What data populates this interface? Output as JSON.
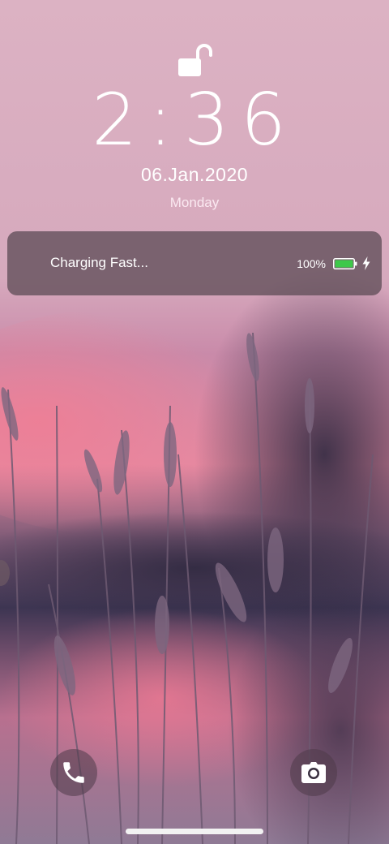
{
  "lock_screen": {
    "lock_icon": "unlocked-padlock-icon",
    "time": "2:36",
    "date": "06.Jan.2020",
    "day": "Monday"
  },
  "notification": {
    "text": "Charging Fast...",
    "battery_percent": "100%",
    "battery_level": 1.0,
    "battery_icon": "battery-full-icon",
    "charging_icon": "lightning-bolt-icon",
    "battery_color": "#3ec84a"
  },
  "shortcuts": {
    "left_icon": "phone-icon",
    "right_icon": "camera-icon"
  },
  "colors": {
    "sky": "#d9b0c2",
    "notification_bg": "#604e58",
    "dusk_glow": "#e8738f"
  }
}
